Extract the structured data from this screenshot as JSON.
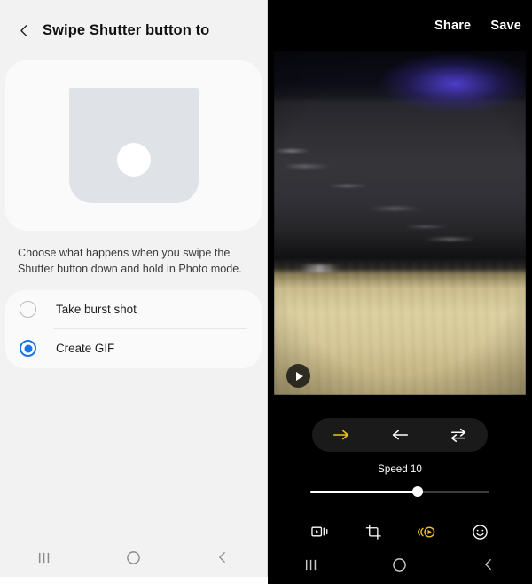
{
  "settings_panel": {
    "header": {
      "back_icon": "chevron-left-icon",
      "title": "Swipe Shutter button to"
    },
    "illustration": {
      "name": "shutter-button-illustration",
      "body_color": "#dfe3e8",
      "dot_color": "#ffffff"
    },
    "description": "Choose what happens when you swipe the Shutter button down and hold in Photo mode.",
    "options": [
      {
        "label": "Take burst shot",
        "selected": false
      },
      {
        "label": "Create GIF",
        "selected": true
      }
    ],
    "accent_color": "#1a73e8",
    "navbar": {
      "recents_icon": "recents-icon",
      "home_icon": "home-circle-icon",
      "back_icon": "back-chevron-icon"
    }
  },
  "editor_panel": {
    "header": {
      "share_label": "Share",
      "save_label": "Save"
    },
    "preview": {
      "name": "gif-preview",
      "play_icon": "play-icon",
      "description": "Motion-blurred photo of a dark keyboard on a light wooden desk with a blue LED glow"
    },
    "direction_controls": [
      {
        "name": "play-forward-button",
        "icon": "arrow-right-icon",
        "active": true
      },
      {
        "name": "play-reverse-button",
        "icon": "arrow-left-icon",
        "active": false
      },
      {
        "name": "play-bounce-button",
        "icon": "swap-arrows-icon",
        "active": false
      }
    ],
    "speed": {
      "label": "Speed 10",
      "value": 10,
      "percent": 60
    },
    "tools": [
      {
        "name": "trim-tool",
        "icon": "video-trim-icon",
        "active": false
      },
      {
        "name": "crop-tool",
        "icon": "crop-icon",
        "active": false
      },
      {
        "name": "speed-tool",
        "icon": "speed-playback-icon",
        "active": true
      },
      {
        "name": "sticker-tool",
        "icon": "smiley-icon",
        "active": false
      }
    ],
    "active_color": "#f0c419",
    "navbar": {
      "recents_icon": "recents-icon",
      "home_icon": "home-circle-icon",
      "back_icon": "back-chevron-icon"
    }
  }
}
